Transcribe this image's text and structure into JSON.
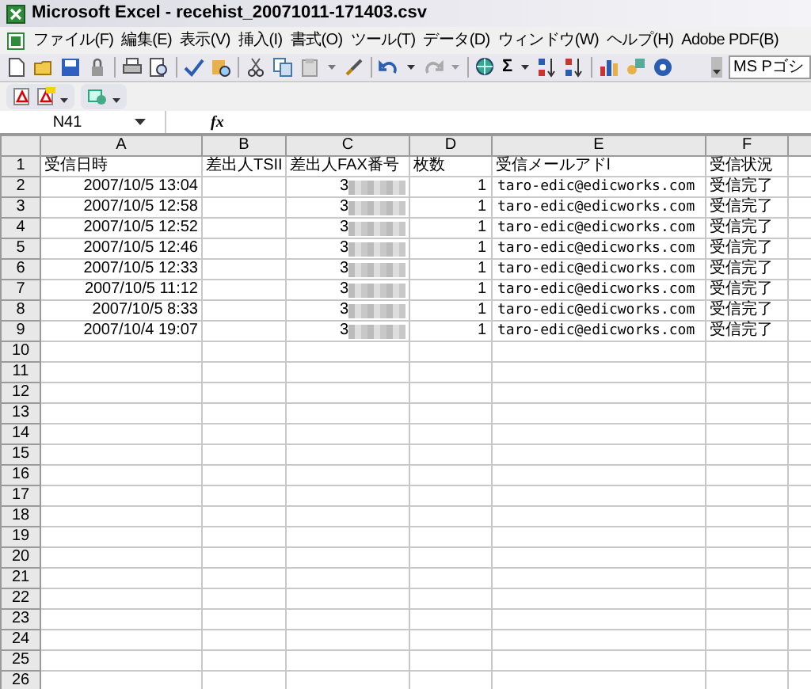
{
  "window": {
    "title": "Microsoft Excel - recehist_20071011-171403.csv"
  },
  "menu": [
    "ファイル(F)",
    "編集(E)",
    "表示(V)",
    "挿入(I)",
    "書式(O)",
    "ツール(T)",
    "データ(D)",
    "ウィンドウ(W)",
    "ヘルプ(H)",
    "Adobe PDF(B)"
  ],
  "toolbar": {
    "autosum": "Σ",
    "font": "MS Pゴシ"
  },
  "formula_bar": {
    "name_box": "N41",
    "function_label": "fx"
  },
  "sheet": {
    "columns": [
      "A",
      "B",
      "C",
      "D",
      "E",
      "F"
    ],
    "rows": [
      {
        "number": "1",
        "cells": [
          "受信日時",
          "差出人TSII",
          "差出人FAX番号",
          "枚数",
          "受信メールアドl",
          "受信状況"
        ]
      },
      {
        "number": "2",
        "cells": [
          "2007/10/5 13:04",
          "",
          "3",
          "1",
          "taro-edic@edicworks.com",
          "受信完了"
        ]
      },
      {
        "number": "3",
        "cells": [
          "2007/10/5 12:58",
          "",
          "3",
          "1",
          "taro-edic@edicworks.com",
          "受信完了"
        ]
      },
      {
        "number": "4",
        "cells": [
          "2007/10/5 12:52",
          "",
          "3",
          "1",
          "taro-edic@edicworks.com",
          "受信完了"
        ]
      },
      {
        "number": "5",
        "cells": [
          "2007/10/5 12:46",
          "",
          "3",
          "1",
          "taro-edic@edicworks.com",
          "受信完了"
        ]
      },
      {
        "number": "6",
        "cells": [
          "2007/10/5 12:33",
          "",
          "3",
          "1",
          "taro-edic@edicworks.com",
          "受信完了"
        ]
      },
      {
        "number": "7",
        "cells": [
          "2007/10/5 11:12",
          "",
          "3",
          "1",
          "taro-edic@edicworks.com",
          "受信完了"
        ]
      },
      {
        "number": "8",
        "cells": [
          "2007/10/5 8:33",
          "",
          "3",
          "1",
          "taro-edic@edicworks.com",
          "受信完了"
        ]
      },
      {
        "number": "9",
        "cells": [
          "2007/10/4 19:07",
          "",
          "3",
          "1",
          "taro-edic@edicworks.com",
          "受信完了"
        ]
      },
      {
        "number": "10",
        "cells": []
      },
      {
        "number": "11",
        "cells": []
      },
      {
        "number": "12",
        "cells": []
      },
      {
        "number": "13",
        "cells": []
      },
      {
        "number": "14",
        "cells": []
      },
      {
        "number": "15",
        "cells": []
      },
      {
        "number": "16",
        "cells": []
      },
      {
        "number": "17",
        "cells": []
      },
      {
        "number": "18",
        "cells": []
      },
      {
        "number": "19",
        "cells": []
      },
      {
        "number": "20",
        "cells": []
      },
      {
        "number": "21",
        "cells": []
      },
      {
        "number": "22",
        "cells": []
      },
      {
        "number": "23",
        "cells": []
      },
      {
        "number": "24",
        "cells": []
      },
      {
        "number": "25",
        "cells": []
      },
      {
        "number": "26",
        "cells": []
      }
    ]
  }
}
